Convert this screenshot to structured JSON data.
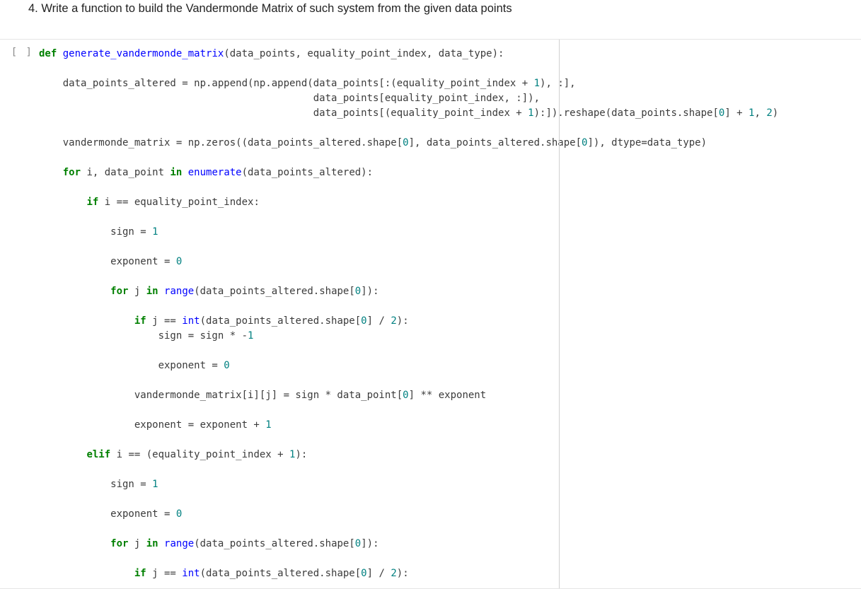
{
  "heading": "4. Write a function to build the Vandermonde Matrix of such system from the given data points",
  "prompt": "[ ]",
  "code": {
    "fn_name": "generate_vandermonde_matrix",
    "params": "(data_points, equality_point_index, data_type):",
    "l1": "    data_points_altered = np.append(np.append(data_points[:(equality_point_index + ",
    "l1n1": "1",
    "l1b": "), :],",
    "l2": "                                              data_points[equality_point_index, :]),",
    "l3": "                                              data_points[(equality_point_index + ",
    "l3n1": "1",
    "l3b": "):]).reshape(data_points.shape[",
    "l3n2": "0",
    "l3c": "] + ",
    "l3n3": "1",
    "l3d": ", ",
    "l3n4": "2",
    "l3e": ")",
    "l4": "    vandermonde_matrix = np.zeros((data_points_altered.shape[",
    "l4n1": "0",
    "l4b": "], data_points_altered.shape[",
    "l4n2": "0",
    "l4c": "]), dtype=data_type)",
    "for1a": "    ",
    "for1b": " i, data_point ",
    "for1c": " ",
    "for1d": "(data_points_altered):",
    "if1a": "        ",
    "if1b": " i == equality_point_index:",
    "sgn1a": "            sign = ",
    "sgn1n": "1",
    "exp1a": "            exponent = ",
    "exp1n": "0",
    "for2a": "            ",
    "for2b": " j ",
    "for2c": " ",
    "for2d": "(data_points_altered.shape[",
    "for2n": "0",
    "for2e": "]):",
    "if2a": "                ",
    "if2b": " j == ",
    "if2c": "(data_points_altered.shape[",
    "if2n": "0",
    "if2d": "] / ",
    "if2n2": "2",
    "if2e": "):",
    "mul1a": "                    sign = sign * -",
    "mul1n": "1",
    "exp2a": "                    exponent = ",
    "exp2n": "0",
    "vm1a": "                vandermonde_matrix[i][j] = sign * data_point[",
    "vm1n": "0",
    "vm1b": "] ** exponent",
    "inc1a": "                exponent = exponent + ",
    "inc1n": "1",
    "elif1a": "        ",
    "elif1b": " i == (equality_point_index + ",
    "elif1n": "1",
    "elif1c": "):",
    "sgn2a": "            sign = ",
    "sgn2n": "1",
    "exp3a": "            exponent = ",
    "exp3n": "0",
    "for3a": "            ",
    "for3b": " j ",
    "for3c": " ",
    "for3d": "(data_points_altered.shape[",
    "for3n": "0",
    "for3e": "]):",
    "cut_a": "                ",
    "cut_b": " j == ",
    "cut_c": "(data_points_altered.shape[",
    "cut_n": "0",
    "cut_d": "] / ",
    "cut_n2": "2",
    "cut_e": "):",
    "kw_def": "def",
    "kw_for": "for",
    "kw_in": "in",
    "kw_if": "if",
    "kw_elif": "elif",
    "bi_enumerate": "enumerate",
    "bi_range": "range",
    "bi_int": "int"
  }
}
